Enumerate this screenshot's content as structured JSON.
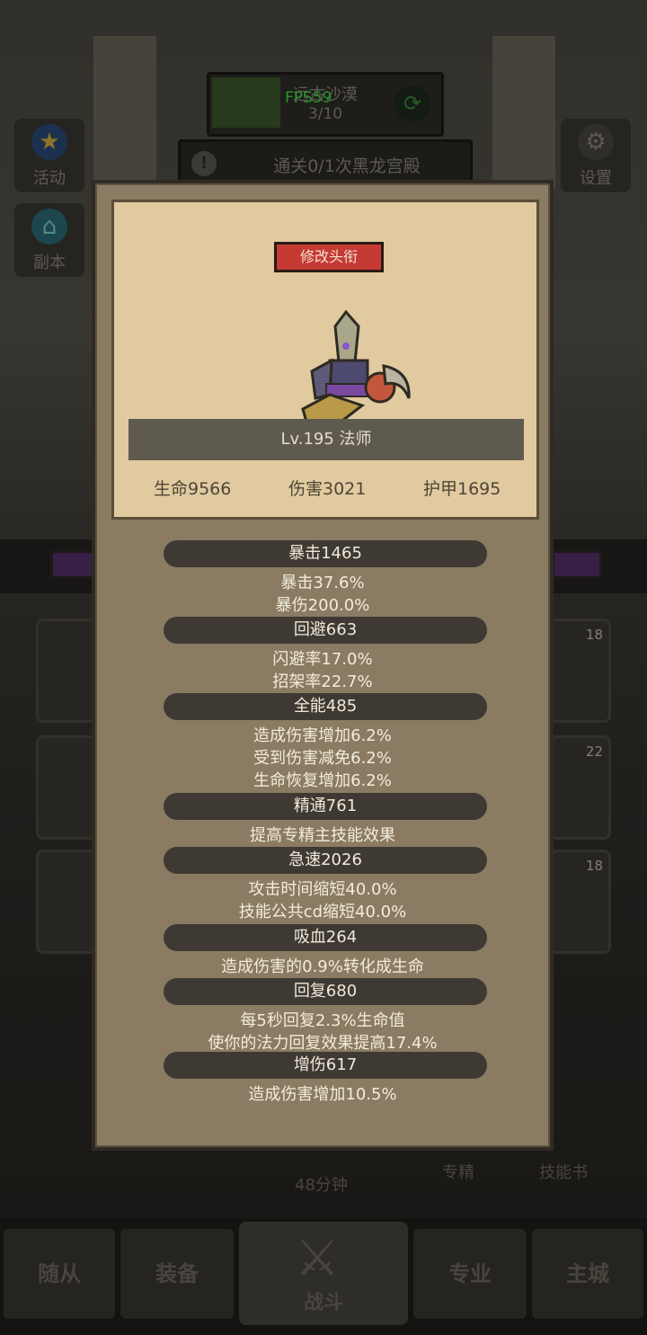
{
  "hud": {
    "stage_name": "远古沙漠",
    "stage_progress": "3/10",
    "fps": "FPS59",
    "quest": "通关0/1次黑龙宫殿",
    "activity_label": "活动",
    "dungeon_label": "副本",
    "settings_label": "设置"
  },
  "background": {
    "slot_badges": [
      "18",
      "22",
      "18"
    ],
    "timer": "48分钟",
    "specialty_label": "专精",
    "skillbook_label": "技能书"
  },
  "nav": {
    "followers": "随从",
    "equipment": "装备",
    "battle": "战斗",
    "profession": "专业",
    "main_city": "主城"
  },
  "profile": {
    "change_title_button": "修改头衔",
    "level_class": "Lv.195 法师",
    "hp": "生命9566",
    "damage": "伤害3021",
    "armor": "护甲1695"
  },
  "stats": [
    {
      "header": "暴击1465",
      "lines": [
        "暴击37.6%",
        "暴伤200.0%"
      ]
    },
    {
      "header": "回避663",
      "lines": [
        "闪避率17.0%",
        "招架率22.7%"
      ]
    },
    {
      "header": "全能485",
      "lines": [
        "造成伤害增加6.2%",
        "受到伤害减免6.2%",
        "生命恢复增加6.2%"
      ]
    },
    {
      "header": "精通761",
      "lines": [
        "提高专精主技能效果"
      ]
    },
    {
      "header": "急速2026",
      "lines": [
        "攻击时间缩短40.0%",
        "技能公共cd缩短40.0%"
      ]
    },
    {
      "header": "吸血264",
      "lines": [
        "造成伤害的0.9%转化成生命"
      ]
    },
    {
      "header": "回复680",
      "lines": [
        "每5秒回复2.3%生命值",
        "使你的法力回复效果提高17.4%"
      ]
    },
    {
      "header": "增伤617",
      "lines": [
        "造成伤害增加10.5%"
      ]
    }
  ]
}
